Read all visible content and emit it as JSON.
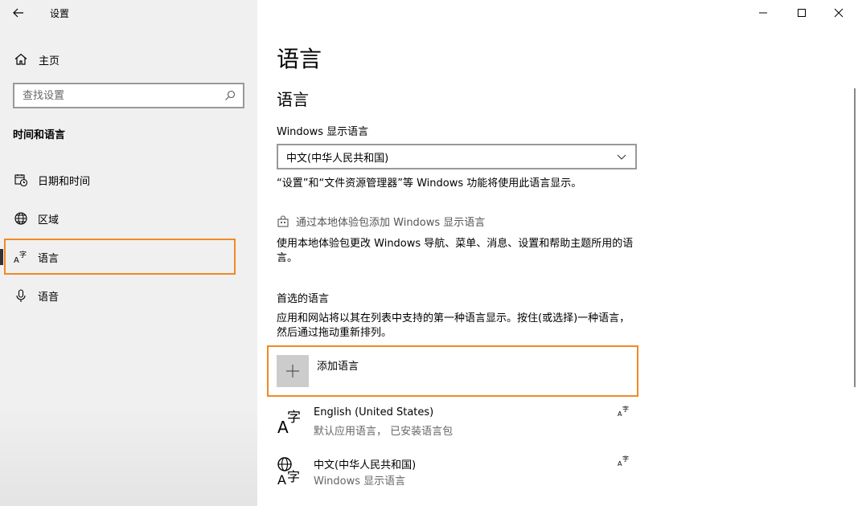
{
  "window": {
    "title": "设置",
    "controls": [
      "minimize",
      "maximize",
      "close"
    ]
  },
  "sidebar": {
    "home_label": "主页",
    "search_placeholder": "查找设置",
    "section_title": "时间和语言",
    "items": [
      {
        "label": "日期和时间",
        "icon": "date-time-icon"
      },
      {
        "label": "区域",
        "icon": "globe-icon"
      },
      {
        "label": "语言",
        "icon": "language-icon",
        "selected": true
      },
      {
        "label": "语音",
        "icon": "microphone-icon"
      }
    ]
  },
  "main": {
    "page_title": "语言",
    "section_title": "语言",
    "display_lang_label": "Windows 显示语言",
    "display_lang_value": "中文(中华人民共和国)",
    "display_lang_desc": "“设置”和“文件资源管理器”等 Windows 功能将使用此语言显示。",
    "store_link": "通过本地体验包添加 Windows 显示语言",
    "store_desc": "使用本地体验包更改 Windows 导航、菜单、消息、设置和帮助主题所用的语言。",
    "preferred_title": "首选的语言",
    "preferred_desc": "应用和网站将以其在列表中支持的第一种语言显示。按住(或选择)一种语言，然后通过拖动重新排列。",
    "add_language_label": "添加语言",
    "languages": [
      {
        "name": "English (United States)",
        "sub": "默认应用语言， 已安装语言包"
      },
      {
        "name": "中文(中华人民共和国)",
        "sub": "Windows 显示语言"
      }
    ]
  },
  "colors": {
    "sidebar_bg": "#f0f0f0",
    "highlight_border": "#f08a24",
    "add_tile": "#cccccc"
  }
}
